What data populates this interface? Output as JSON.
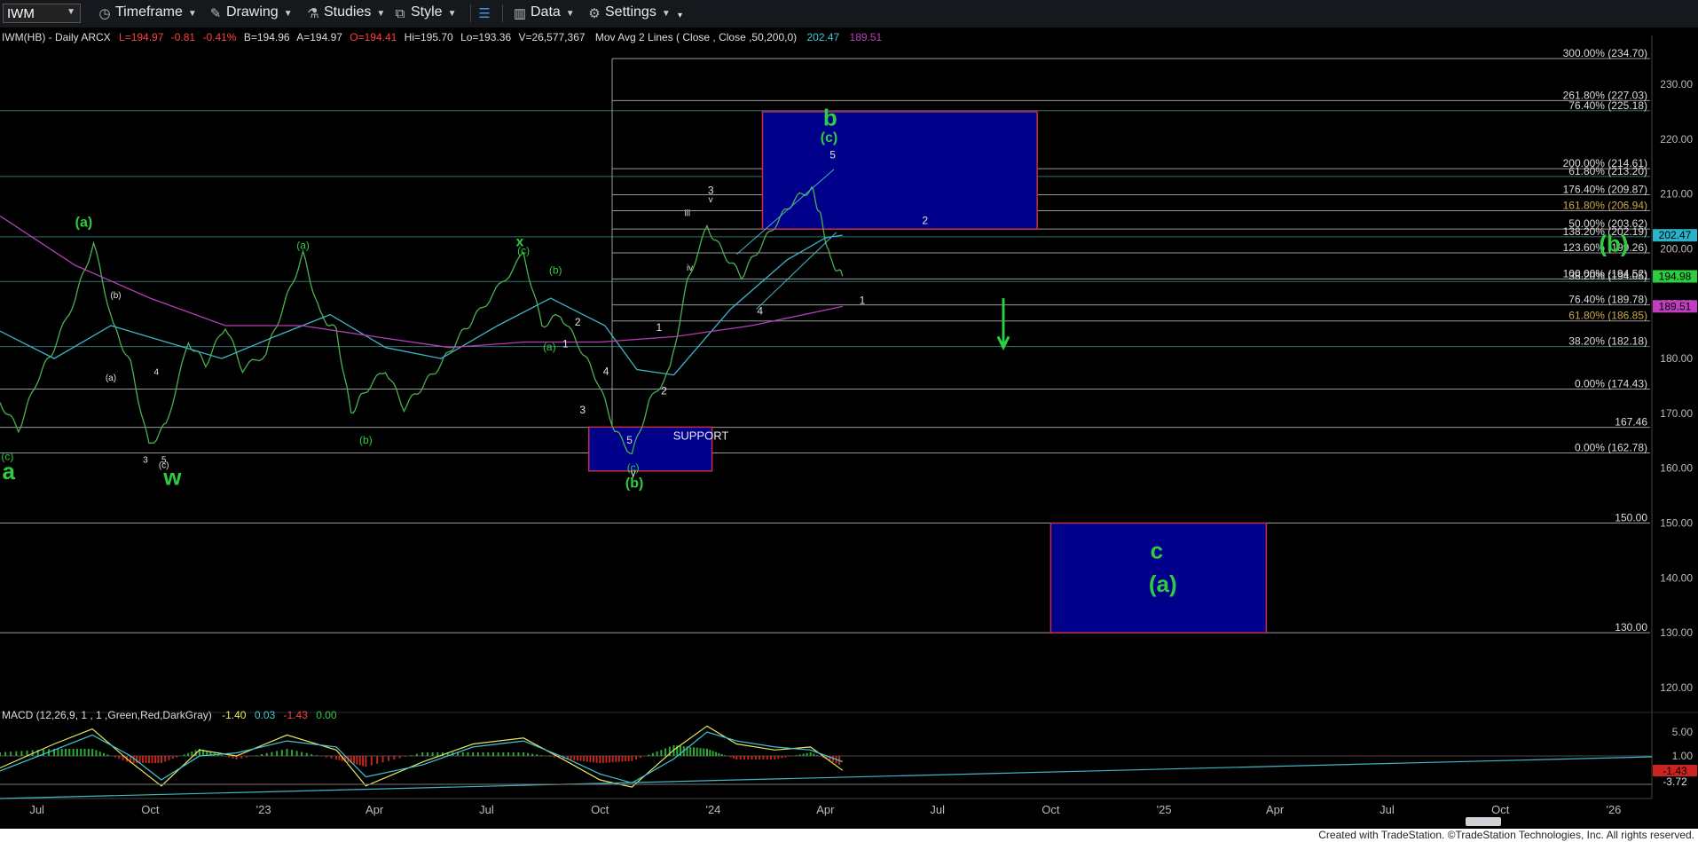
{
  "toolbar": {
    "symbol": "IWM",
    "timeframe": "Timeframe",
    "drawing": "Drawing",
    "studies": "Studies",
    "style": "Style",
    "data": "Data",
    "settings": "Settings"
  },
  "header": {
    "name": "IWM(HB) - Daily  ARCX",
    "last": "L=194.97",
    "chg": "-0.81",
    "pct": "-0.41%",
    "bid": "B=194.96",
    "ask": "A=194.97",
    "open": "O=194.41",
    "high": "Hi=195.70",
    "low": "Lo=193.36",
    "vol": "V=26,577,367",
    "study": "Mov Avg 2 Lines ( Close , Close ,50,200,0)",
    "ma50": "202.47",
    "ma200": "189.51"
  },
  "macd_header": {
    "label": "MACD (12,26,9, 1 , 1 ,Green,Red,DarkGray)",
    "v1": "-1.40",
    "v2": "0.03",
    "v3": "-1.43",
    "v4": "0.00"
  },
  "colors": {
    "price": "#4caf50",
    "ma50": "#3fb5c8",
    "ma200": "#b43fb4",
    "label": "#2ecc40",
    "box": "#00008b",
    "boxborder": "#c0304a"
  },
  "footer": "Created with TradeStation. ©TradeStation Technologies, Inc. All rights reserved.",
  "chart_data": {
    "type": "line",
    "ylim": [
      115,
      237
    ],
    "y_ticks": [
      120,
      130,
      140,
      150,
      160,
      170,
      180,
      190,
      200,
      210,
      220,
      230
    ],
    "x_ticks": [
      {
        "label": "Jul",
        "date": "2022-07-01"
      },
      {
        "label": "Oct",
        "date": "2022-10-01"
      },
      {
        "label": "'23",
        "date": "2023-01-01"
      },
      {
        "label": "Apr",
        "date": "2023-04-01"
      },
      {
        "label": "Jul",
        "date": "2023-07-01"
      },
      {
        "label": "Oct",
        "date": "2023-10-01"
      },
      {
        "label": "'24",
        "date": "2024-01-01"
      },
      {
        "label": "Apr",
        "date": "2024-04-01"
      },
      {
        "label": "Jul",
        "date": "2024-07-01"
      },
      {
        "label": "Oct",
        "date": "2024-10-01"
      },
      {
        "label": "'25",
        "date": "2025-01-01"
      },
      {
        "label": "Apr",
        "date": "2025-04-01"
      },
      {
        "label": "Jul",
        "date": "2025-07-01"
      },
      {
        "label": "Oct",
        "date": "2025-10-01"
      },
      {
        "label": "'26",
        "date": "2026-01-01"
      }
    ],
    "price_badges": [
      {
        "label": "202.47",
        "value": 202.47,
        "color": "#2ab3c8"
      },
      {
        "label": "194.98",
        "value": 194.98,
        "color": "#2ecc40"
      },
      {
        "label": "189.51",
        "value": 189.51,
        "color": "#c03fc0"
      }
    ],
    "series": [
      {
        "x": [
          "2022-06-01",
          "2022-06-16",
          "2022-07-01",
          "2022-07-15",
          "2022-08-01",
          "2022-08-16",
          "2022-09-01",
          "2022-09-15",
          "2022-09-30",
          "2022-10-14",
          "2022-11-01",
          "2022-11-15",
          "2022-12-01",
          "2022-12-15",
          "2023-01-03",
          "2023-01-18",
          "2023-02-02",
          "2023-02-16",
          "2023-03-01",
          "2023-03-13",
          "2023-03-24",
          "2023-04-10",
          "2023-04-25",
          "2023-05-10",
          "2023-05-25",
          "2023-06-09",
          "2023-06-23",
          "2023-07-11",
          "2023-07-31",
          "2023-08-15",
          "2023-08-30",
          "2023-09-15",
          "2023-09-29",
          "2023-10-13",
          "2023-10-27",
          "2023-11-10",
          "2023-11-27",
          "2023-12-11",
          "2023-12-27",
          "2024-01-10",
          "2024-01-24",
          "2024-02-07",
          "2024-02-22",
          "2024-03-07",
          "2024-03-21",
          "2024-03-28",
          "2024-04-05",
          "2024-04-15"
        ],
        "values": [
          172,
          167,
          176,
          182,
          191,
          201,
          186,
          179,
          164,
          168,
          183,
          179,
          186,
          178,
          181,
          190,
          199,
          188,
          185,
          170,
          174,
          178,
          171,
          175,
          179,
          184,
          188,
          193,
          199,
          186,
          188,
          182,
          176,
          167,
          162.5,
          172,
          178,
          194,
          204,
          199,
          195,
          200,
          205,
          209,
          211,
          206,
          198,
          195
        ]
      },
      {
        "name": "",
        "x": [
          "2022-06-01",
          "2022-07-15",
          "2022-08-30",
          "2022-10-14",
          "2022-11-28",
          "2023-01-10",
          "2023-02-24",
          "2023-04-10",
          "2023-05-25",
          "2023-07-10",
          "2023-08-22",
          "2023-10-05",
          "2023-10-31",
          "2023-11-30",
          "2024-01-15",
          "2024-03-01",
          "2024-04-01",
          "2024-04-15"
        ],
        "values": [
          185,
          180,
          186,
          183,
          180,
          184,
          188,
          182,
          180,
          186,
          191,
          186,
          178,
          177,
          189,
          198,
          202,
          202.5
        ]
      },
      {
        "x": [
          "2022-06-01",
          "2022-08-01",
          "2022-10-01",
          "2022-12-01",
          "2023-02-01",
          "2023-04-01",
          "2023-06-01",
          "2023-08-01",
          "2023-10-01",
          "2023-12-01",
          "2024-02-01",
          "2024-04-15"
        ],
        "values": [
          206,
          197,
          191,
          186,
          186,
          184,
          182,
          183,
          183,
          184,
          186,
          189.5
        ]
      }
    ],
    "annotations": {
      "fib_lines": [
        {
          "label": "300.00% (234.70)",
          "value": 234.7
        },
        {
          "label": "261.80% (227.03)",
          "value": 227.03
        },
        {
          "label": "76.40% (225.18)",
          "value": 225.18
        },
        {
          "label": "200.00% (214.61)",
          "value": 214.61
        },
        {
          "label": "61.80% (213.20)",
          "value": 213.2
        },
        {
          "label": "176.40% (209.87)",
          "value": 209.87
        },
        {
          "label": "161.80% (206.94)",
          "value": 206.94
        },
        {
          "label": "50.00% (203.62)",
          "value": 203.62
        },
        {
          "label": "138.20% (202.19)",
          "value": 202.19
        },
        {
          "label": "123.60% (199.26)",
          "value": 199.26
        },
        {
          "label": "100.00% (194.52)",
          "value": 194.52
        },
        {
          "label": "38.20% (194.05)",
          "value": 194.05
        },
        {
          "label": "76.40% (189.78)",
          "value": 189.78
        },
        {
          "label": "61.80% (186.85)",
          "value": 186.85
        },
        {
          "label": "38.20% (182.18)",
          "value": 182.18
        },
        {
          "label": "0.00% (174.43)",
          "value": 174.43
        },
        {
          "label": "167.46",
          "value": 167.46
        },
        {
          "label": "0.00% (162.78)",
          "value": 162.78
        },
        {
          "label": "150.00",
          "value": 150
        },
        {
          "label": "130.00",
          "value": 130
        }
      ],
      "boxes": [
        {
          "label": "",
          "x0": "2024-02-10",
          "x1": "2024-09-20",
          "y0": 203.6,
          "y1": 225
        },
        {
          "label": "SUPPORT",
          "x0": "2023-09-22",
          "x1": "2023-12-31",
          "y0": 159.5,
          "y1": 167.5
        },
        {
          "label": "",
          "x0": "2024-10-01",
          "x1": "2025-03-25",
          "y0": 130,
          "y1": 150
        }
      ],
      "wave_labels": [
        {
          "text": "a",
          "date": "2022-06-08",
          "value": 158,
          "size": "big"
        },
        {
          "text": "(c)",
          "date": "2022-06-07",
          "value": 161.5,
          "size": "small"
        },
        {
          "text": "(a)",
          "date": "2022-08-08",
          "value": 204,
          "size": "mid"
        },
        {
          "text": "(b)",
          "date": "2022-09-03",
          "value": 191,
          "size": "tiny"
        },
        {
          "text": "(a)",
          "date": "2022-08-30",
          "value": 176,
          "size": "tiny"
        },
        {
          "text": "4",
          "date": "2022-10-06",
          "value": 177,
          "size": "tiny"
        },
        {
          "text": "3",
          "date": "2022-09-27",
          "value": 161,
          "size": "tiny"
        },
        {
          "text": "5",
          "date": "2022-10-12",
          "value": 161,
          "size": "tiny"
        },
        {
          "text": "(c)",
          "date": "2022-10-12",
          "value": 160,
          "size": "tiny"
        },
        {
          "text": "w",
          "date": "2022-10-19",
          "value": 157,
          "size": "big"
        },
        {
          "text": "(a)",
          "date": "2023-02-02",
          "value": 200,
          "size": "small"
        },
        {
          "text": "(b)",
          "date": "2023-03-25",
          "value": 164.5,
          "size": "small"
        },
        {
          "text": "x",
          "date": "2023-07-28",
          "value": 200.5,
          "size": "mid"
        },
        {
          "text": "(c)",
          "date": "2023-07-31",
          "value": 199,
          "size": "small"
        },
        {
          "text": "(b)",
          "date": "2023-08-26",
          "value": 195.5,
          "size": "small"
        },
        {
          "text": "2",
          "date": "2023-09-13",
          "value": 186,
          "size": "small"
        },
        {
          "text": "(a)",
          "date": "2023-08-21",
          "value": 181.5,
          "size": "small"
        },
        {
          "text": "1",
          "date": "2023-09-03",
          "value": 182,
          "size": "small"
        },
        {
          "text": "4",
          "date": "2023-10-06",
          "value": 177,
          "size": "small"
        },
        {
          "text": "3",
          "date": "2023-09-17",
          "value": 170,
          "size": "small"
        },
        {
          "text": "5",
          "date": "2023-10-25",
          "value": 164.5,
          "size": "small"
        },
        {
          "text": "(c)",
          "date": "2023-10-28",
          "value": 159.5,
          "size": "small"
        },
        {
          "text": "y",
          "date": "2023-10-28",
          "value": 158.5,
          "size": "small"
        },
        {
          "text": "(b)",
          "date": "2023-10-29",
          "value": 156.5,
          "size": "mid"
        },
        {
          "text": "1",
          "date": "2023-11-18",
          "value": 185,
          "size": "small"
        },
        {
          "text": "2",
          "date": "2023-11-22",
          "value": 173.5,
          "size": "small"
        },
        {
          "text": "iii",
          "date": "2023-12-11",
          "value": 206,
          "size": "tiny"
        },
        {
          "text": "iv",
          "date": "2023-12-13",
          "value": 196,
          "size": "tiny"
        },
        {
          "text": "3",
          "date": "2023-12-30",
          "value": 210,
          "size": "small"
        },
        {
          "text": "v",
          "date": "2023-12-30",
          "value": 208.5,
          "size": "tiny"
        },
        {
          "text": "4",
          "date": "2024-02-08",
          "value": 188,
          "size": "small"
        },
        {
          "text": "b",
          "date": "2024-04-05",
          "value": 222.5,
          "size": "big"
        },
        {
          "text": "(c)",
          "date": "2024-04-04",
          "value": 219.5,
          "size": "mid"
        },
        {
          "text": "5",
          "date": "2024-04-07",
          "value": 216.5,
          "size": "small"
        },
        {
          "text": "2",
          "date": "2024-06-21",
          "value": 204.5,
          "size": "small"
        },
        {
          "text": "1",
          "date": "2024-05-01",
          "value": 190,
          "size": "small"
        },
        {
          "text": "(b)",
          "date": "2026-01-01",
          "value": 199.5,
          "size": "big"
        },
        {
          "text": "c",
          "date": "2024-12-26",
          "value": 143.5,
          "size": "big"
        },
        {
          "text": "(a)",
          "date": "2024-12-31",
          "value": 137.5,
          "size": "big"
        }
      ]
    }
  },
  "macd_data": {
    "y_ticks": [
      "5.00",
      "1.00",
      "-3.00"
    ],
    "badges": [
      {
        "label": "-3.72",
        "color": "#000000"
      },
      {
        "label": "-1.43",
        "color": "#cc2222"
      }
    ],
    "x": [
      "2022-06-01",
      "2022-07-15",
      "2022-08-15",
      "2022-09-15",
      "2022-10-10",
      "2022-11-10",
      "2022-12-10",
      "2023-01-20",
      "2023-03-01",
      "2023-03-25",
      "2023-05-10",
      "2023-06-20",
      "2023-07-31",
      "2023-09-05",
      "2023-10-01",
      "2023-10-27",
      "2023-11-30",
      "2023-12-27",
      "2024-01-20",
      "2024-02-20",
      "2024-03-20",
      "2024-04-15"
    ],
    "macd": [
      -1,
      3,
      5.5,
      0,
      -4,
      2,
      1,
      4.5,
      2,
      -4,
      0,
      3,
      4,
      0,
      -3,
      -4.2,
      2,
      6,
      3,
      2,
      2.5,
      -1.4
    ],
    "signal": [
      -1.5,
      2,
      4.5,
      1,
      -3,
      1,
      1.5,
      3.5,
      2.5,
      -2.5,
      -0.5,
      2.5,
      3.5,
      0.5,
      -2,
      -3.5,
      0.5,
      5,
      3.5,
      2.5,
      2,
      0.03
    ]
  }
}
